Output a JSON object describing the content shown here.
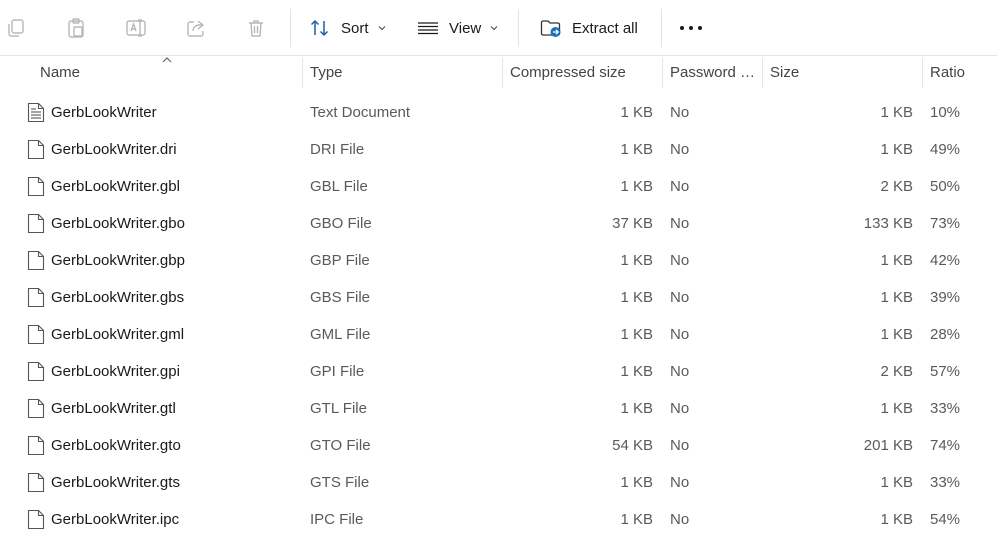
{
  "toolbar": {
    "sort_label": "Sort",
    "view_label": "View",
    "extract_label": "Extract all",
    "more_label": "•••",
    "icons": [
      "copy-icon",
      "paste-icon",
      "rename-icon",
      "share-icon",
      "delete-icon",
      "sort-icon",
      "view-icon",
      "extract-folder-icon",
      "more-icon"
    ]
  },
  "columns": {
    "name": "Name",
    "type": "Type",
    "compressed": "Compressed size",
    "password": "Password p...",
    "size": "Size",
    "ratio": "Ratio"
  },
  "files": [
    {
      "name": "GerbLookWriter",
      "type": "Text Document",
      "compressed": "1 KB",
      "password": "No",
      "size": "1 KB",
      "ratio": "10%",
      "icon": "text-document-icon"
    },
    {
      "name": "GerbLookWriter.dri",
      "type": "DRI File",
      "compressed": "1 KB",
      "password": "No",
      "size": "1 KB",
      "ratio": "49%",
      "icon": "file-icon"
    },
    {
      "name": "GerbLookWriter.gbl",
      "type": "GBL File",
      "compressed": "1 KB",
      "password": "No",
      "size": "2 KB",
      "ratio": "50%",
      "icon": "file-icon"
    },
    {
      "name": "GerbLookWriter.gbo",
      "type": "GBO File",
      "compressed": "37 KB",
      "password": "No",
      "size": "133 KB",
      "ratio": "73%",
      "icon": "file-icon"
    },
    {
      "name": "GerbLookWriter.gbp",
      "type": "GBP File",
      "compressed": "1 KB",
      "password": "No",
      "size": "1 KB",
      "ratio": "42%",
      "icon": "file-icon"
    },
    {
      "name": "GerbLookWriter.gbs",
      "type": "GBS File",
      "compressed": "1 KB",
      "password": "No",
      "size": "1 KB",
      "ratio": "39%",
      "icon": "file-icon"
    },
    {
      "name": "GerbLookWriter.gml",
      "type": "GML File",
      "compressed": "1 KB",
      "password": "No",
      "size": "1 KB",
      "ratio": "28%",
      "icon": "file-icon"
    },
    {
      "name": "GerbLookWriter.gpi",
      "type": "GPI File",
      "compressed": "1 KB",
      "password": "No",
      "size": "2 KB",
      "ratio": "57%",
      "icon": "file-icon"
    },
    {
      "name": "GerbLookWriter.gtl",
      "type": "GTL File",
      "compressed": "1 KB",
      "password": "No",
      "size": "1 KB",
      "ratio": "33%",
      "icon": "file-icon"
    },
    {
      "name": "GerbLookWriter.gto",
      "type": "GTO File",
      "compressed": "54 KB",
      "password": "No",
      "size": "201 KB",
      "ratio": "74%",
      "icon": "file-icon"
    },
    {
      "name": "GerbLookWriter.gts",
      "type": "GTS File",
      "compressed": "1 KB",
      "password": "No",
      "size": "1 KB",
      "ratio": "33%",
      "icon": "file-icon"
    },
    {
      "name": "GerbLookWriter.ipc",
      "type": "IPC File",
      "compressed": "1 KB",
      "password": "No",
      "size": "1 KB",
      "ratio": "54%",
      "icon": "file-icon"
    }
  ],
  "colors": {
    "accent": "#0067c0",
    "disabled_icon": "#b8b8b8",
    "divider": "#e5e5e5"
  }
}
